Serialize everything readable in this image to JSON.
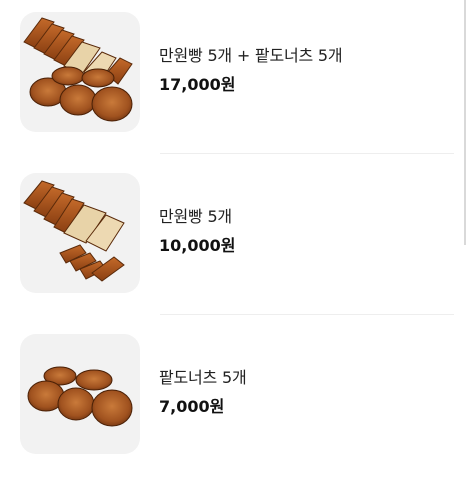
{
  "menu": {
    "items": [
      {
        "name": "만원빵 5개 + 팥도너츠 5개",
        "price": "17,000원",
        "image": "bread-and-donuts-image"
      },
      {
        "name": "만원빵 5개",
        "price": "10,000원",
        "image": "bread-image"
      },
      {
        "name": "팥도너츠 5개",
        "price": "7,000원",
        "image": "donuts-image"
      }
    ]
  }
}
